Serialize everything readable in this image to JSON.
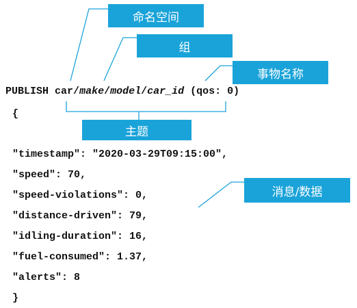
{
  "labels": {
    "namespace": "命名空间",
    "group": "组",
    "thing_name": "事物名称",
    "topic": "主题",
    "message": "消息/数据"
  },
  "command": {
    "keyword": "PUBLISH",
    "seg_car": "car",
    "seg_make": "make",
    "seg_model": "model",
    "seg_car_id": "car_id",
    "sep": "/",
    "qos": "(qos: 0)"
  },
  "payload": {
    "open_brace": "{",
    "close_brace": "}",
    "lines": [
      "\"timestamp\": \"2020-03-29T09:15:00\",",
      "\"speed\": 70,",
      "\"speed-violations\": 0,",
      "\"distance-driven\": 79,",
      "\"idling-duration\": 16,",
      "\"fuel-consumed\": 1.37,",
      "\"alerts\": 8"
    ]
  },
  "colors": {
    "label_bg": "#1aa3d9",
    "leader_line": "#1aa3d9",
    "code_text": "#111111"
  }
}
